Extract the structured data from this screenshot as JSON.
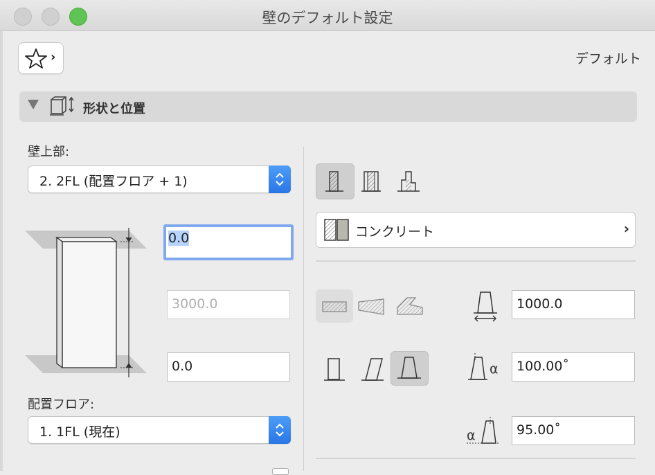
{
  "window": {
    "title": "壁のデフォルト設定"
  },
  "header": {
    "favorites_icon": "star-icon",
    "default_label": "デフォルト"
  },
  "section": {
    "title": "形状と位置",
    "icon": "wall-geometry-icon"
  },
  "top_link": {
    "label": "壁上部:",
    "selected": "2. 2FL (配置フロア + 1)"
  },
  "home_story": {
    "label": "配置フロア:",
    "selected": "1. 1FL (現在)"
  },
  "elevation": {
    "top_offset": "0.0",
    "height": "3000.0",
    "bottom_offset": "0.0"
  },
  "right": {
    "composite_name": "コンクリート",
    "thickness": "1000.0",
    "angle_1": "100.00˚",
    "angle_2": "95.00˚",
    "alpha_symbol": "α"
  },
  "colors": {
    "accent": "#2f80ed",
    "focus_ring": "#7fa8ee",
    "section_bar": "#d9d9d9"
  }
}
